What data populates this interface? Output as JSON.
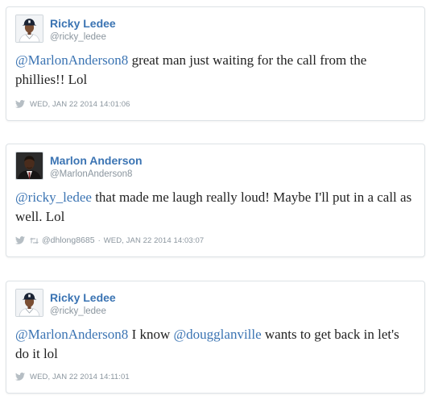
{
  "tweets": [
    {
      "author": {
        "name": "Ricky Ledee",
        "handle": "@ricky_ledee",
        "avatar_icon": "player-avatar-icon"
      },
      "body": {
        "mention": "@MarlonAnderson8",
        "text": " great man just waiting for the call from the phillies!! Lol"
      },
      "meta": {
        "date": "WED, JAN 22 2014 14:01:06"
      }
    },
    {
      "author": {
        "name": "Marlon Anderson",
        "handle": "@MarlonAnderson8",
        "avatar_icon": "player-avatar-icon"
      },
      "body": {
        "mention": "@ricky_ledee",
        "text": " that made me laugh really loud! Maybe I'll put in a call as well. Lol"
      },
      "meta": {
        "retweeted_by": "@dhlong8685",
        "separator": "·",
        "date": "WED, JAN 22 2014 14:03:07"
      }
    },
    {
      "author": {
        "name": "Ricky Ledee",
        "handle": "@ricky_ledee",
        "avatar_icon": "player-avatar-icon"
      },
      "body": {
        "mention": "@MarlonAnderson8",
        "text_a": " I know ",
        "mention_b": "@dougglanville",
        "text_b": " wants to get back in let's do it lol"
      },
      "meta": {
        "date": "WED, JAN 22 2014 14:11:01"
      }
    }
  ],
  "colors": {
    "link": "#3b74b3",
    "muted": "#8a959e",
    "text": "#222222",
    "border": "#dde2e6"
  }
}
